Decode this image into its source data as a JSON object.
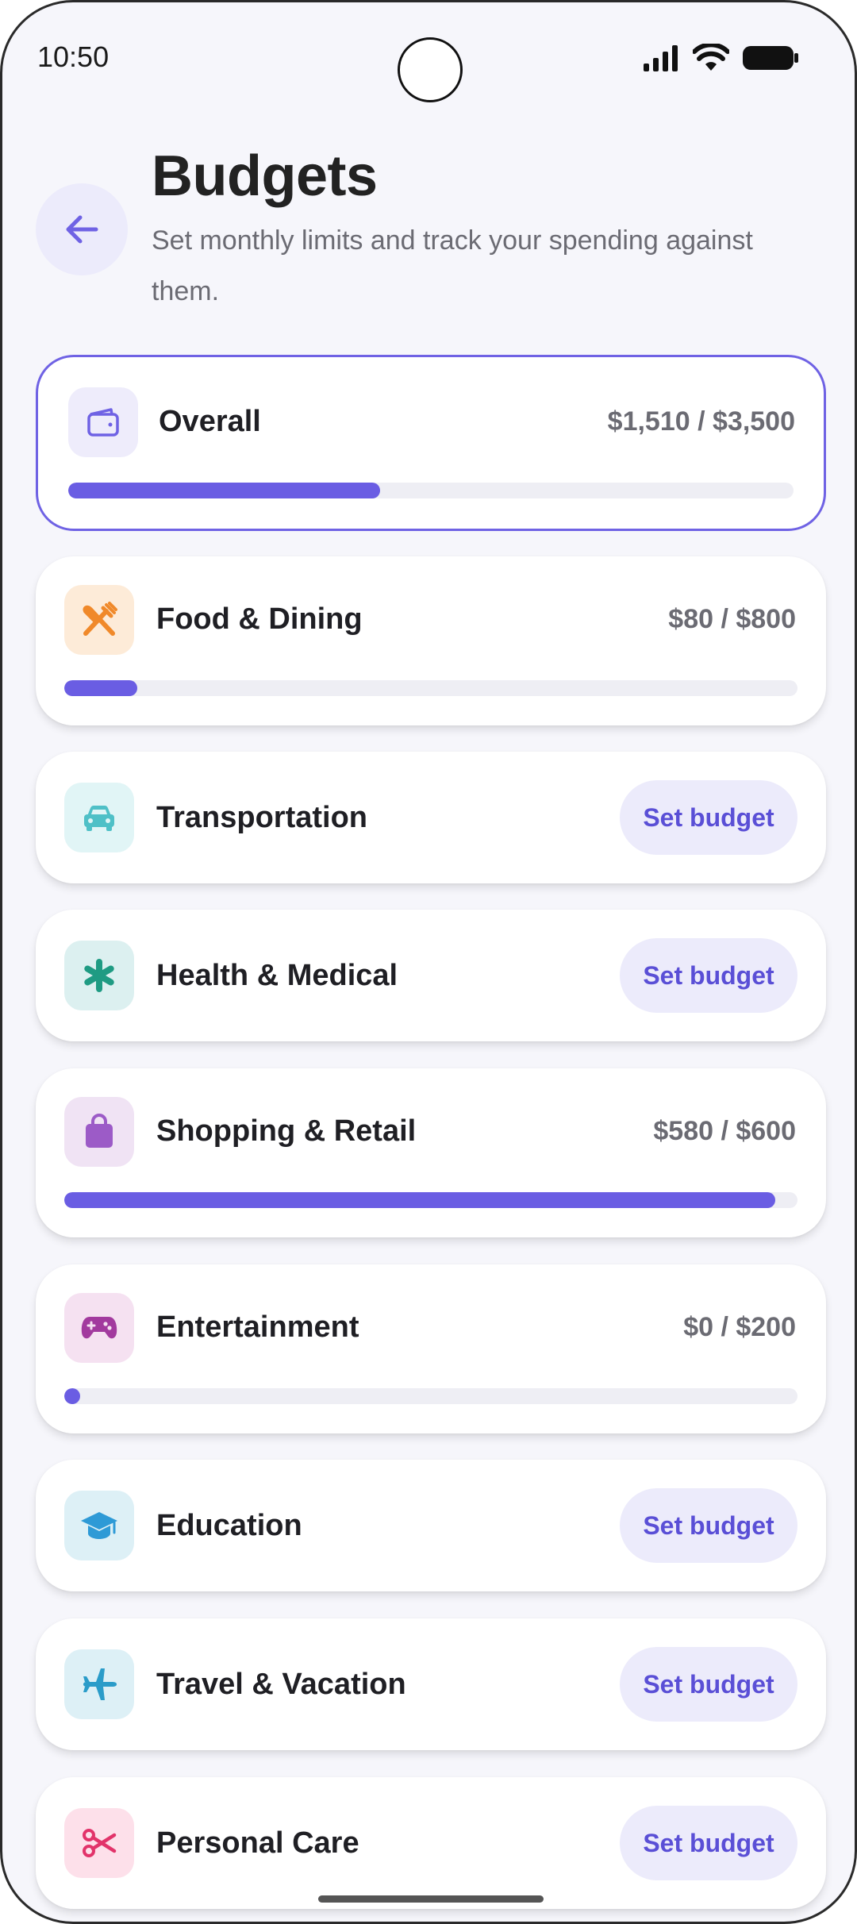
{
  "status": {
    "time": "10:50"
  },
  "header": {
    "title": "Budgets",
    "subtitle": "Set monthly limits and track your spending against them."
  },
  "overall": {
    "name": "Overall",
    "amount": "$1,510 / $3,500",
    "progress": 0.43,
    "icon": "wallet-icon"
  },
  "categories": [
    {
      "name": "Food & Dining",
      "amount": "$80 / $800",
      "progress": 0.1,
      "has_budget": true,
      "icon": "fork-knife-icon",
      "icon_color": "#f0892a",
      "icon_bg": "#fdebd8"
    },
    {
      "name": "Transportation",
      "set_label": "Set budget",
      "has_budget": false,
      "icon": "car-icon",
      "icon_color": "#4fc0c7",
      "icon_bg": "#e1f5f6"
    },
    {
      "name": "Health & Medical",
      "set_label": "Set budget",
      "has_budget": false,
      "icon": "medical-asterisk-icon",
      "icon_color": "#1f9b83",
      "icon_bg": "#dcf0f0"
    },
    {
      "name": "Shopping & Retail",
      "amount": "$580 / $600",
      "progress": 0.97,
      "has_budget": true,
      "icon": "shopping-bag-icon",
      "icon_color": "#9c5bc7",
      "icon_bg": "#f0e3f4"
    },
    {
      "name": "Entertainment",
      "amount": "$0 / $200",
      "progress": 0.0,
      "has_budget": true,
      "icon": "gamepad-icon",
      "icon_color": "#a23a9e",
      "icon_bg": "#f5e1f1"
    },
    {
      "name": "Education",
      "set_label": "Set budget",
      "has_budget": false,
      "icon": "graduation-cap-icon",
      "icon_color": "#2e9ad6",
      "icon_bg": "#ddf0f6"
    },
    {
      "name": "Travel & Vacation",
      "set_label": "Set budget",
      "has_budget": false,
      "icon": "airplane-icon",
      "icon_color": "#2a9cc9",
      "icon_bg": "#ddf0f6"
    },
    {
      "name": "Personal Care",
      "set_label": "Set budget",
      "has_budget": false,
      "icon": "scissors-icon",
      "icon_color": "#e2336a",
      "icon_bg": "#fde0ea"
    }
  ],
  "colors": {
    "accent": "#6a5de3",
    "track": "#eeeef4",
    "button_bg": "#ecebfb"
  }
}
